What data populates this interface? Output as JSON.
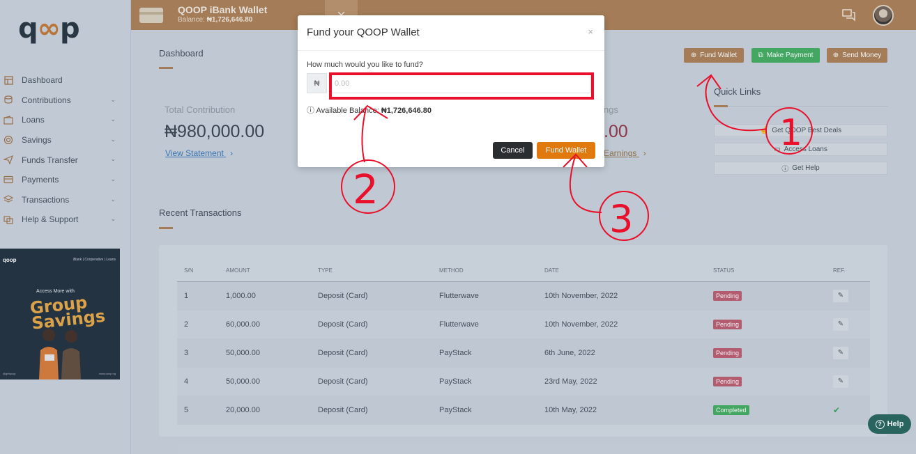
{
  "brand": {
    "logo_left": "q",
    "logo_mid": "∞",
    "logo_right": "p"
  },
  "sidebar": {
    "items": [
      {
        "label": "Dashboard",
        "icon": "dashboard-icon",
        "has_chevron": false
      },
      {
        "label": "Contributions",
        "icon": "coins-icon",
        "has_chevron": true
      },
      {
        "label": "Loans",
        "icon": "wallet-icon",
        "has_chevron": true
      },
      {
        "label": "Savings",
        "icon": "target-icon",
        "has_chevron": true
      },
      {
        "label": "Funds Transfer",
        "icon": "send-icon",
        "has_chevron": true
      },
      {
        "label": "Payments",
        "icon": "card-icon",
        "has_chevron": true
      },
      {
        "label": "Transactions",
        "icon": "layers-icon",
        "has_chevron": true
      },
      {
        "label": "Help & Support",
        "icon": "support-icon",
        "has_chevron": true
      }
    ],
    "chevron": "⌄",
    "promo": {
      "logo": "qoop",
      "tagline": "iBank | Cooperative | Loans",
      "headline": "Access More with",
      "big_text": "Group Savings",
      "handle": "@getqoop",
      "site": "www.qoop.ng"
    }
  },
  "topbar": {
    "title": "QOOP iBank Wallet",
    "balance_label": "Balance:",
    "balance_value": "₦1,726,646.80",
    "close_glyph": "×"
  },
  "dashboard": {
    "title": "Dashboard",
    "actions": {
      "fund_wallet": "Fund Wallet",
      "make_payment": "Make Payment",
      "send_money": "Send Money"
    },
    "total_contribution": {
      "label": "Total Contribution",
      "value": "₦980,000.00",
      "link": "View Statement"
    },
    "earnings": {
      "label_partial": "ngs",
      "value_partial": ".00",
      "link_partial": "Earnings"
    },
    "quick_links": {
      "title": "Quick Links",
      "items": [
        "Get QOOP Best Deals",
        "Access Loans",
        "Get Help"
      ]
    }
  },
  "recent": {
    "title": "Recent Transactions",
    "columns": [
      "S/N",
      "AMOUNT",
      "TYPE",
      "METHOD",
      "DATE",
      "STATUS",
      "REF."
    ],
    "rows": [
      {
        "sn": "1",
        "amount": "1,000.00",
        "type": "Deposit (Card)",
        "method": "Flutterwave",
        "date": "10th November, 2022",
        "status": "Pending"
      },
      {
        "sn": "2",
        "amount": "60,000.00",
        "type": "Deposit (Card)",
        "method": "Flutterwave",
        "date": "10th November, 2022",
        "status": "Pending"
      },
      {
        "sn": "3",
        "amount": "50,000.00",
        "type": "Deposit (Card)",
        "method": "PayStack",
        "date": "6th June, 2022",
        "status": "Pending"
      },
      {
        "sn": "4",
        "amount": "50,000.00",
        "type": "Deposit (Card)",
        "method": "PayStack",
        "date": "23rd May, 2022",
        "status": "Pending"
      },
      {
        "sn": "5",
        "amount": "20,000.00",
        "type": "Deposit (Card)",
        "method": "PayStack",
        "date": "10th May, 2022",
        "status": "Completed"
      }
    ]
  },
  "help": {
    "label": "Help",
    "glyph": "?"
  },
  "modal": {
    "title": "Fund your QOOP Wallet",
    "close": "×",
    "question": "How much would you like to fund?",
    "currency": "₦",
    "amount_value": "",
    "amount_placeholder": "0.00",
    "available_label": "Available Balance:",
    "available_value": "₦1,726,646.80",
    "cancel": "Cancel",
    "submit": "Fund Wallet"
  },
  "annotations": {
    "color": "#e8102a",
    "labels": [
      "1",
      "2",
      "3"
    ]
  }
}
